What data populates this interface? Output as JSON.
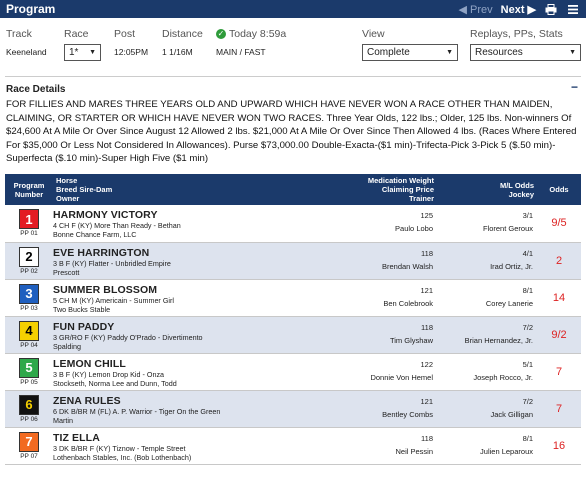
{
  "header": {
    "title": "Program",
    "prev_label": "◀ Prev",
    "next_label": "Next ▶"
  },
  "info": {
    "track_label": "Track",
    "race_label": "Race",
    "post_label": "Post",
    "distance_label": "Distance",
    "today_label": "Today 8:59a",
    "view_label": "View",
    "replays_label": "Replays, PPs, Stats",
    "track_value": "Keeneland",
    "race_value": "1*",
    "post_value": "12:05PM",
    "distance_value": "1 1/16M",
    "surface_value": "MAIN / FAST",
    "view_value": "Complete",
    "replays_value": "Resources"
  },
  "race_details": {
    "heading": "Race Details",
    "toggle": "−",
    "text": "FOR FILLIES AND MARES THREE YEARS OLD AND UPWARD WHICH HAVE NEVER WON A RACE OTHER THAN MAIDEN, CLAIMING, OR STARTER OR WHICH HAVE NEVER WON TWO RACES. Three Year Olds, 122 lbs.; Older, 125 lbs. Non-winners Of $24,600 At A Mile Or Over Since August 12 Allowed 2 lbs. $21,000 At A Mile Or Over Since Then Allowed 4 lbs. (Races Where Entered For $35,000 Or Less Not Considered In Allowances). Purse $73,000.00 Double-Exacta-($1 min)-Trifecta-Pick 3-Pick 5 ($.50 min)-Superfecta ($.10 min)-Super High Five ($1 min)"
  },
  "table": {
    "col_program_1": "Program",
    "col_program_2": "Number",
    "col_horse_1": "Horse",
    "col_horse_2": "Breed Sire-Dam",
    "col_horse_3": "Owner",
    "col_med_1": "Medication Weight",
    "col_med_2": "Claiming Price",
    "col_med_3": "Trainer",
    "col_ml_1": "M/L Odds",
    "col_ml_2": "Jockey",
    "col_odds": "Odds",
    "rows": [
      {
        "num": "1",
        "pp": "PP 01",
        "name": "HARMONY VICTORY",
        "breed": "4 CH F (KY) More Than Ready - Bethan",
        "owner": "Bonne Chance Farm, LLC",
        "weight": "125",
        "trainer": "Paulo Lobo",
        "ml": "3/1",
        "jockey": "Florent Geroux",
        "odds": "9/5",
        "bg": "#e31b23",
        "fg": "#ffffff"
      },
      {
        "num": "2",
        "pp": "PP 02",
        "name": "EVE HARRINGTON",
        "breed": "3 B F (KY) Flatter - Unbridled Empire",
        "owner": "Prescott",
        "weight": "118",
        "trainer": "Brendan Walsh",
        "ml": "4/1",
        "jockey": "Irad Ortiz, Jr.",
        "odds": "2",
        "bg": "#ffffff",
        "fg": "#000000"
      },
      {
        "num": "3",
        "pp": "PP 03",
        "name": "SUMMER BLOSSOM",
        "breed": "5 CH M (KY) Americain - Summer Girl",
        "owner": "Two Bucks Stable",
        "weight": "121",
        "trainer": "Ben Colebrook",
        "ml": "8/1",
        "jockey": "Corey Lanerie",
        "odds": "14",
        "bg": "#1f5fbf",
        "fg": "#ffffff"
      },
      {
        "num": "4",
        "pp": "PP 04",
        "name": "FUN PADDY",
        "breed": "3 GR/RO F (KY) Paddy O'Prado - Divertimento",
        "owner": "Spalding",
        "weight": "118",
        "trainer": "Tim Glyshaw",
        "ml": "7/2",
        "jockey": "Brian Hernandez, Jr.",
        "odds": "9/2",
        "bg": "#f5d000",
        "fg": "#000000"
      },
      {
        "num": "5",
        "pp": "PP 05",
        "name": "LEMON CHILL",
        "breed": "3 B F (KY) Lemon Drop Kid - Onza",
        "owner": "Stockseth, Norma Lee and Dunn, Todd",
        "weight": "122",
        "trainer": "Donnie Von Hemel",
        "ml": "5/1",
        "jockey": "Joseph Rocco, Jr.",
        "odds": "7",
        "bg": "#2ea84a",
        "fg": "#ffffff"
      },
      {
        "num": "6",
        "pp": "PP 06",
        "name": "ZENA RULES",
        "breed": "6 DK B/BR M (FL) A. P. Warrior - Tiger On the Green",
        "owner": "Martin",
        "weight": "121",
        "trainer": "Bentley Combs",
        "ml": "7/2",
        "jockey": "Jack Gilligan",
        "odds": "7",
        "bg": "#111111",
        "fg": "#f5d000"
      },
      {
        "num": "7",
        "pp": "PP 07",
        "name": "TIZ ELLA",
        "breed": "3 DK B/BR F (KY) Tiznow - Temple Street",
        "owner": "Lothenbach Stables, Inc. (Bob Lothenbach)",
        "weight": "118",
        "trainer": "Neil Pessin",
        "ml": "8/1",
        "jockey": "Julien Leparoux",
        "odds": "16",
        "bg": "#f26a21",
        "fg": "#ffffff"
      }
    ]
  }
}
